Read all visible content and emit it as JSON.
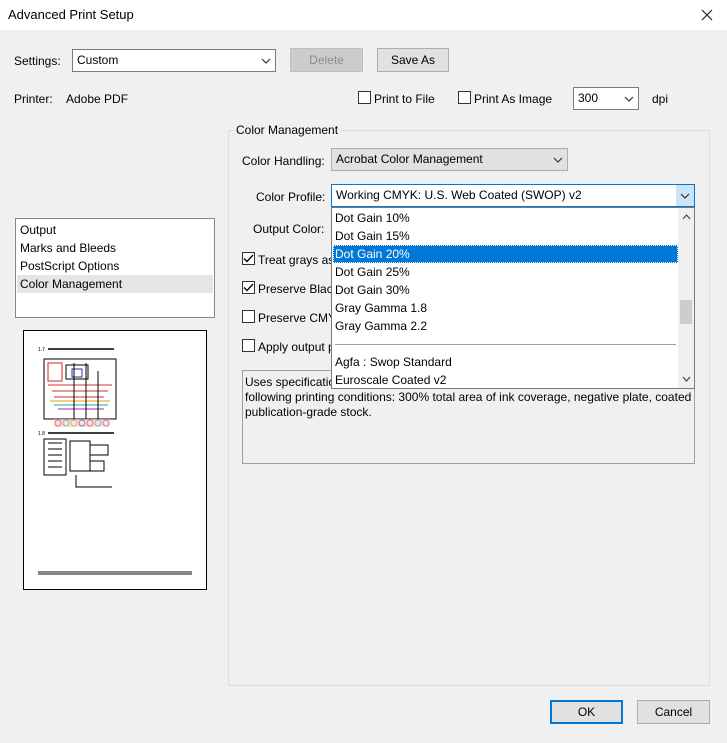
{
  "window": {
    "title": "Advanced Print Setup"
  },
  "settings": {
    "label": "Settings:",
    "value": "Custom",
    "delete_label": "Delete",
    "save_as_label": "Save As"
  },
  "printer": {
    "label": "Printer:",
    "name": "Adobe PDF",
    "print_to_file": "Print to File",
    "print_as_image": "Print As Image",
    "dpi_value": "300",
    "dpi_unit": "dpi"
  },
  "sidebar": {
    "items": [
      {
        "label": "Output"
      },
      {
        "label": "Marks and Bleeds"
      },
      {
        "label": "PostScript Options"
      },
      {
        "label": "Color Management"
      }
    ],
    "selected_index": 3
  },
  "color_management": {
    "group_title": "Color Management",
    "color_handling_label": "Color Handling:",
    "color_handling_value": "Acrobat Color Management",
    "color_profile_label": "Color Profile:",
    "color_profile_value": "Working CMYK: U.S. Web Coated (SWOP) v2",
    "output_color_label": "Output Color:",
    "treat_grays_label": "Treat grays as",
    "treat_grays_checked": true,
    "preserve_black_label": "Preserve Black",
    "preserve_black_checked": true,
    "preserve_cmyk_label": "Preserve CMYK",
    "preserve_cmyk_checked": false,
    "apply_output_label": "Apply output pr",
    "apply_output_checked": false,
    "description_visible_start": "Uses specification",
    "description_rest": "following printing conditions: 300% total area of ink coverage, negative plate, coated publication-grade stock."
  },
  "profile_dropdown": {
    "items": [
      {
        "label": "Dot Gain 10%"
      },
      {
        "label": "Dot Gain 15%"
      },
      {
        "label": "Dot Gain 20%"
      },
      {
        "label": "Dot Gain 25%"
      },
      {
        "label": "Dot Gain 30%"
      },
      {
        "label": "Gray Gamma 1.8"
      },
      {
        "label": "Gray Gamma 2.2"
      },
      {
        "label": "Agfa : Swop Standard"
      },
      {
        "label": "Euroscale Coated v2"
      }
    ],
    "highlighted_index": 2
  },
  "footer": {
    "ok_label": "OK",
    "cancel_label": "Cancel"
  },
  "colors": {
    "accent": "#0078d7",
    "highlight": "#0078d7",
    "background": "#f0f0f0"
  }
}
